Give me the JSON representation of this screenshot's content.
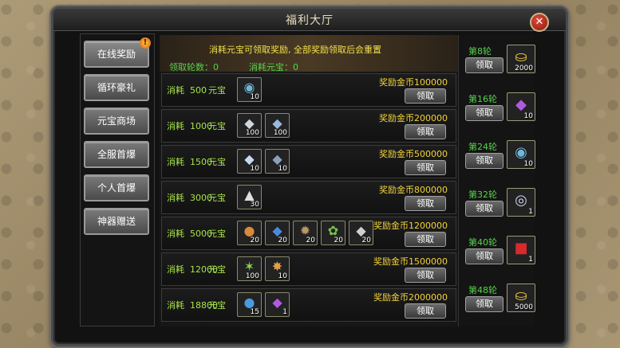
{
  "title": "福利大厅",
  "close": "✕",
  "sidebar": {
    "items": [
      {
        "label": "在线奖励",
        "badge": "!"
      },
      {
        "label": "循环豪礼"
      },
      {
        "label": "元宝商场"
      },
      {
        "label": "全服首爆"
      },
      {
        "label": "个人首爆"
      },
      {
        "label": "神器赠送"
      }
    ]
  },
  "header": {
    "notice": "消耗元宝可领取奖励, 全部奖励领取后会重置",
    "rounds_label": "领取轮数：0",
    "spent_label": "消耗元宝：0"
  },
  "unit": "元宝",
  "claim_label": "领取",
  "rows": [
    {
      "cost": "消耗  500",
      "reward": "奖励金币100000",
      "items": [
        {
          "icon": "jade-bead",
          "glyph": "◉",
          "color": "#6fb6d8",
          "qty": "10"
        }
      ]
    },
    {
      "cost": "消耗  1000",
      "reward": "奖励金币200000",
      "items": [
        {
          "icon": "silver-ore",
          "glyph": "◆",
          "color": "#cfd6de",
          "qty": "100"
        },
        {
          "icon": "crystal-shard",
          "glyph": "◆",
          "color": "#9ab8e0",
          "qty": "100"
        }
      ]
    },
    {
      "cost": "消耗  1500",
      "reward": "奖励金币500000",
      "items": [
        {
          "icon": "crystal-shard",
          "glyph": "◆",
          "color": "#c8d8f0",
          "qty": "10"
        },
        {
          "icon": "ore-chunk",
          "glyph": "◆",
          "color": "#8aa0b8",
          "qty": "10"
        }
      ]
    },
    {
      "cost": "消耗  3000",
      "reward": "奖励金币800000",
      "items": [
        {
          "icon": "silver-ingot",
          "glyph": "▲",
          "color": "#e0e0e0",
          "qty": "30"
        }
      ]
    },
    {
      "cost": "消耗  5000",
      "reward": "奖励金币1200000",
      "items": [
        {
          "icon": "gold-pouch",
          "glyph": "●",
          "color": "#d88a3a",
          "qty": "20"
        },
        {
          "icon": "blue-gem",
          "glyph": "◆",
          "color": "#4a8ad8",
          "qty": "20"
        },
        {
          "icon": "bronze-relic",
          "glyph": "✹",
          "color": "#b89a6a",
          "qty": "20"
        },
        {
          "icon": "green-leaf",
          "glyph": "✿",
          "color": "#7ac24a",
          "qty": "20"
        },
        {
          "icon": "silver-relic",
          "glyph": "◆",
          "color": "#d0d0d0",
          "qty": "20"
        }
      ]
    },
    {
      "cost": "消耗  12000",
      "reward": "奖励金币1500000",
      "items": [
        {
          "icon": "green-crystal",
          "glyph": "✶",
          "color": "#8ad84a",
          "qty": "100"
        },
        {
          "icon": "fire-orb",
          "glyph": "✸",
          "color": "#e0a04a",
          "qty": "10"
        }
      ]
    },
    {
      "cost": "消耗  18800",
      "reward": "奖励金币2000000",
      "items": [
        {
          "icon": "blue-pearl",
          "glyph": "●",
          "color": "#4a9ae0",
          "qty": "15"
        },
        {
          "icon": "purple-gem",
          "glyph": "◆",
          "color": "#b05ae0",
          "qty": "1"
        }
      ]
    }
  ],
  "rounds": [
    {
      "label": "第8轮",
      "icon": "gold-ingot",
      "glyph": "⛀",
      "color": "#f2c83a",
      "qty": "2000"
    },
    {
      "label": "第16轮",
      "icon": "purple-gem",
      "glyph": "◆",
      "color": "#b05ae0",
      "qty": "10"
    },
    {
      "label": "第24轮",
      "icon": "jade-bead",
      "glyph": "◉",
      "color": "#6fb6d8",
      "qty": "10"
    },
    {
      "label": "第32轮",
      "icon": "silver-ring",
      "glyph": "◎",
      "color": "#c8d8e8",
      "qty": "1"
    },
    {
      "label": "第40轮",
      "icon": "red-envelope",
      "glyph": "■",
      "color": "#d82a2a",
      "qty": "1"
    },
    {
      "label": "第48轮",
      "icon": "gold-ingot",
      "glyph": "⛀",
      "color": "#f2c83a",
      "qty": "5000"
    }
  ]
}
